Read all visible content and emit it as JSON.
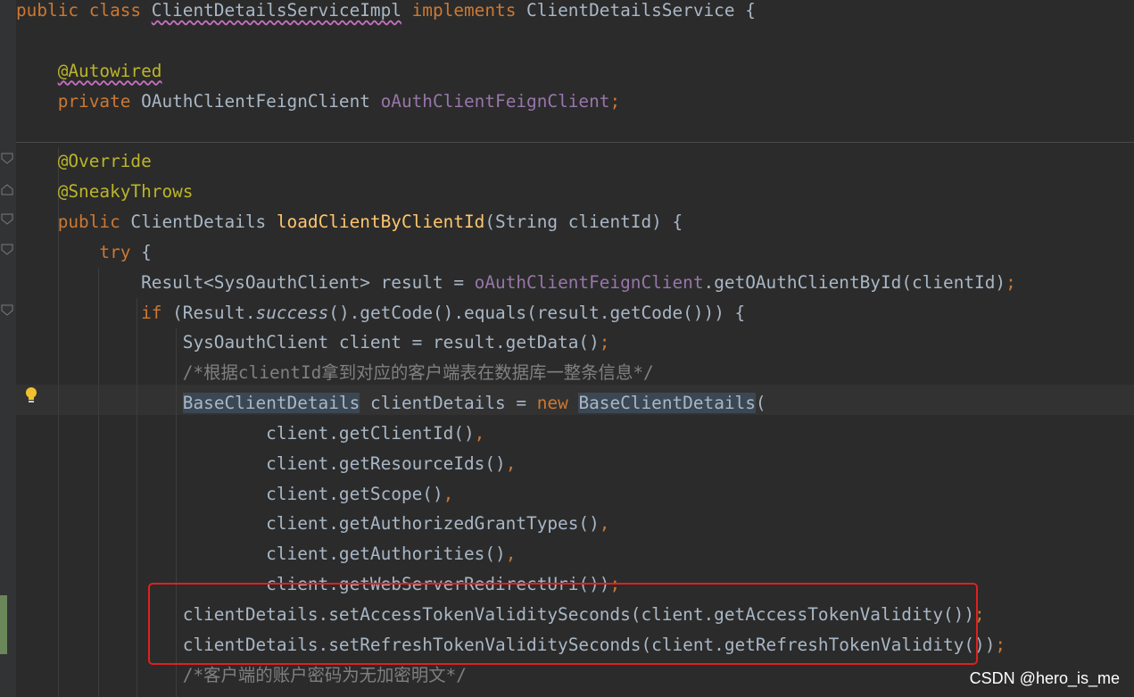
{
  "editor": {
    "lines": [
      {
        "tokens": [
          {
            "t": "public class ",
            "c": "kw"
          },
          {
            "t": "ClientDetailsServiceImpl",
            "c": "squig"
          },
          {
            "t": " implements ",
            "c": "kw"
          },
          {
            "t": "ClientDetailsService {",
            "c": ""
          }
        ]
      },
      {
        "tokens": []
      },
      {
        "tokens": [
          {
            "t": "    ",
            "c": ""
          },
          {
            "t": "@Autowired",
            "c": "ann squig"
          }
        ]
      },
      {
        "tokens": [
          {
            "t": "    private ",
            "c": "kw"
          },
          {
            "t": "OAuthClientFeignClient ",
            "c": ""
          },
          {
            "t": "oAuthClientFeignClient",
            "c": "fld"
          },
          {
            "t": ";",
            "c": "kw"
          }
        ]
      },
      {
        "tokens": []
      },
      {
        "tokens": [
          {
            "t": "    ",
            "c": ""
          },
          {
            "t": "@Override",
            "c": "ann"
          }
        ]
      },
      {
        "tokens": [
          {
            "t": "    ",
            "c": ""
          },
          {
            "t": "@SneakyThrows",
            "c": "ann"
          }
        ]
      },
      {
        "tokens": [
          {
            "t": "    public ",
            "c": "kw"
          },
          {
            "t": "ClientDetails ",
            "c": ""
          },
          {
            "t": "loadClientByClientId",
            "c": "fn"
          },
          {
            "t": "(String clientId) {",
            "c": ""
          }
        ]
      },
      {
        "tokens": [
          {
            "t": "        try ",
            "c": "kw"
          },
          {
            "t": "{",
            "c": ""
          }
        ]
      },
      {
        "tokens": [
          {
            "t": "            Result<SysOauthClient> result = ",
            "c": ""
          },
          {
            "t": "oAuthClientFeignClient",
            "c": "fld"
          },
          {
            "t": ".getOAuthClientById(clientId)",
            "c": ""
          },
          {
            "t": ";",
            "c": "kw"
          }
        ]
      },
      {
        "tokens": [
          {
            "t": "            if ",
            "c": "kw"
          },
          {
            "t": "(Result.",
            "c": ""
          },
          {
            "t": "success",
            "c": "ital"
          },
          {
            "t": "().getCode().equals(result.getCode())) {",
            "c": ""
          }
        ]
      },
      {
        "tokens": [
          {
            "t": "                SysOauthClient client = result.getData()",
            "c": ""
          },
          {
            "t": ";",
            "c": "kw"
          }
        ]
      },
      {
        "tokens": [
          {
            "t": "                /*根据clientId拿到对应的客户端表在数据库一整条信息*/",
            "c": "cmt"
          }
        ]
      },
      {
        "tokens": [
          {
            "t": "                ",
            "c": ""
          },
          {
            "t": "BaseClientDetails",
            "c": "hl2"
          },
          {
            "t": " clientDetails = ",
            "c": ""
          },
          {
            "t": "new ",
            "c": "kw"
          },
          {
            "t": "BaseClientDetails",
            "c": "hl2"
          },
          {
            "t": "(",
            "c": ""
          }
        ]
      },
      {
        "tokens": [
          {
            "t": "                        client.getClientId()",
            "c": ""
          },
          {
            "t": ",",
            "c": "kw"
          }
        ]
      },
      {
        "tokens": [
          {
            "t": "                        client.getResourceIds()",
            "c": ""
          },
          {
            "t": ",",
            "c": "kw"
          }
        ]
      },
      {
        "tokens": [
          {
            "t": "                        client.getScope()",
            "c": ""
          },
          {
            "t": ",",
            "c": "kw"
          }
        ]
      },
      {
        "tokens": [
          {
            "t": "                        client.getAuthorizedGrantTypes()",
            "c": ""
          },
          {
            "t": ",",
            "c": "kw"
          }
        ]
      },
      {
        "tokens": [
          {
            "t": "                        client.getAuthorities()",
            "c": ""
          },
          {
            "t": ",",
            "c": "kw"
          }
        ]
      },
      {
        "tokens": [
          {
            "t": "                        client.getWebServerRedirectUri())",
            "c": ""
          },
          {
            "t": ";",
            "c": "kw"
          }
        ]
      },
      {
        "tokens": [
          {
            "t": "                clientDetails.setAccessTokenValiditySeconds(client.getAccessTokenValidity())",
            "c": ""
          },
          {
            "t": ";",
            "c": "kw"
          }
        ]
      },
      {
        "tokens": [
          {
            "t": "                clientDetails.setRefreshTokenValiditySeconds(client.getRefreshTokenValidity())",
            "c": ""
          },
          {
            "t": ";",
            "c": "kw"
          }
        ]
      },
      {
        "tokens": [
          {
            "t": "                /*客户端的账户密码为无加密明文*/",
            "c": "cmt"
          }
        ]
      }
    ]
  },
  "watermark": "CSDN @hero_is_me",
  "colors": {
    "background": "#2b2b2b",
    "keyword": "#cc7832",
    "annotation": "#bbb529",
    "field": "#9876aa",
    "method_decl": "#ffc66d",
    "comment": "#808080",
    "text": "#a9b7c6",
    "highlight_box": "#e02020"
  }
}
